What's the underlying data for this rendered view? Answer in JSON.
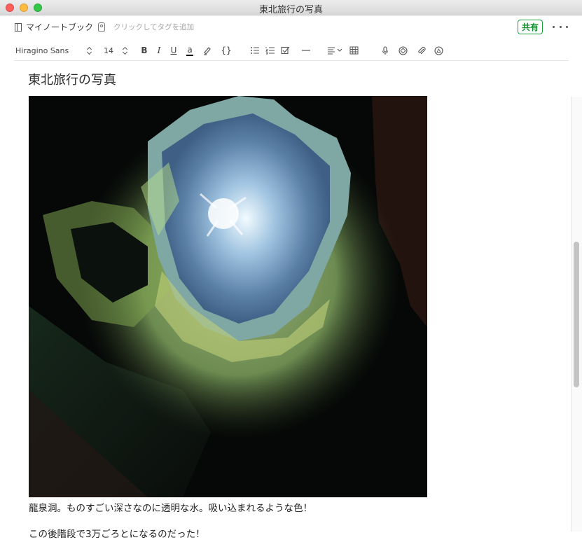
{
  "window": {
    "title": "東北旅行の写真"
  },
  "meta": {
    "notebook": "マイノートブック",
    "tag_placeholder": "クリックしてタグを追加",
    "share_label": "共有"
  },
  "toolbar": {
    "font": "Hiragino Sans",
    "size": "14",
    "bold": "B",
    "italic": "I",
    "underline": "U",
    "text_color": "a",
    "code": "{}"
  },
  "note": {
    "title": "東北旅行の写真",
    "caption": "龍泉洞。ものすごい深さなのに透明な水。吸い込まれるような色！",
    "next_line": "この後階段で3万ごろとになるのだった！"
  },
  "colors": {
    "share_green": "#12912f",
    "close": "#fc605c",
    "minimize": "#fdbc40",
    "maximize": "#34c84a"
  }
}
